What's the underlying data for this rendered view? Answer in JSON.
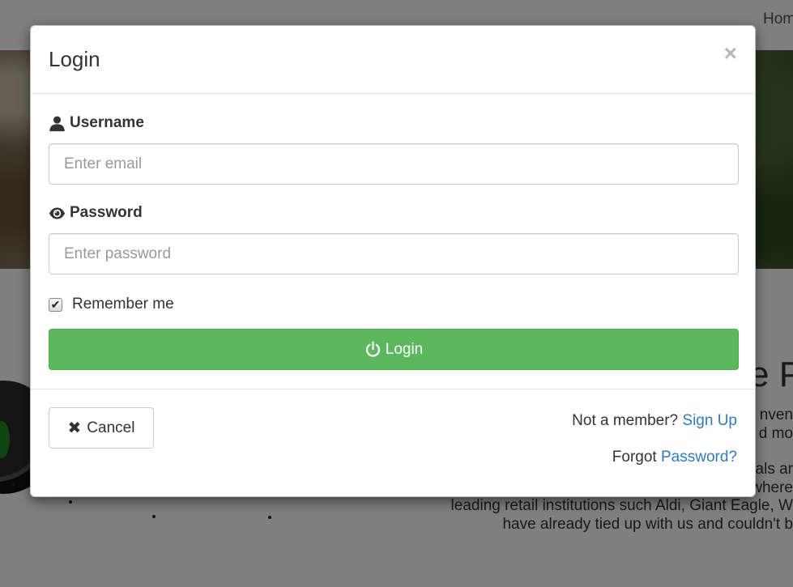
{
  "background": {
    "nav_link": "Hom",
    "heading": "e P",
    "paragraph_lines": [
      "nven",
      "d mo"
    ],
    "paragraph2_lines": [
      "als ar",
      "where",
      "leading retail institutions such Aldi, Giant Eagle, W",
      "have already tied up with us and couldn't b"
    ]
  },
  "modal": {
    "title": "Login",
    "close_symbol": "×",
    "username": {
      "label": "Username",
      "icon": "user-icon",
      "placeholder": "Enter email",
      "value": ""
    },
    "password": {
      "label": "Password",
      "icon": "eye-icon",
      "placeholder": "Enter password",
      "value": ""
    },
    "remember": {
      "label": "Remember me",
      "checked": true,
      "check_glyph": "✔"
    },
    "login_button": {
      "label": "Login",
      "icon": "power-icon"
    },
    "cancel_button": {
      "label": "Cancel",
      "icon": "close-x-icon",
      "glyph": "✖"
    },
    "signup": {
      "prompt": "Not a member?",
      "link": "Sign Up"
    },
    "forgot": {
      "prompt": "Forgot",
      "link": "Password?"
    }
  },
  "colors": {
    "success": "#5cb85c",
    "link": "#337ab7",
    "overlay": "rgba(0,0,0,0.5)"
  }
}
